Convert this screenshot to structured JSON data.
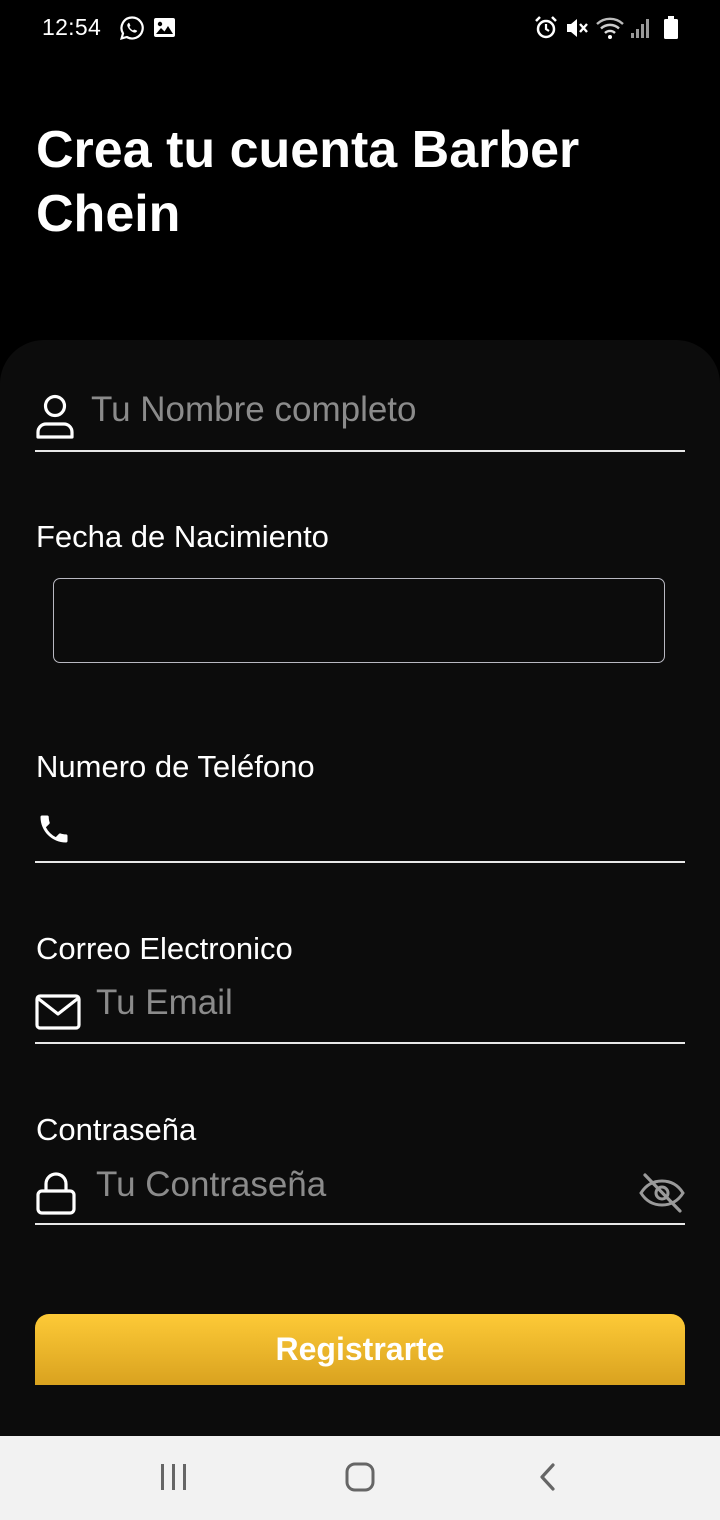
{
  "status_bar": {
    "time": "12:54",
    "left_icons": [
      "whatsapp-icon",
      "gallery-icon"
    ],
    "right_icons": [
      "alarm-icon",
      "mute-icon",
      "wifi-icon",
      "signal-icon",
      "battery-icon"
    ]
  },
  "page": {
    "title": "Crea tu cuenta Barber Chein"
  },
  "form": {
    "name": {
      "placeholder": "Tu Nombre completo",
      "icon": "user-icon"
    },
    "birthdate": {
      "label": "Fecha de Nacimiento",
      "value": ""
    },
    "phone": {
      "label": "Numero de Teléfono",
      "value": "",
      "icon": "phone-icon"
    },
    "email": {
      "label": "Correo Electronico",
      "placeholder": "Tu Email",
      "icon": "mail-icon"
    },
    "password": {
      "label": "Contraseña",
      "placeholder": "Tu Contraseña",
      "icon": "lock-icon",
      "toggle_icon": "eye-off-icon"
    },
    "submit_label": "Registrarte"
  },
  "colors": {
    "background": "#000000",
    "sheet": "#0c0c0c",
    "accent": "#fdca37",
    "placeholder": "#8b8b8b"
  },
  "nav_bar": {
    "buttons": [
      "recent-apps-icon",
      "home-icon",
      "back-icon"
    ]
  }
}
